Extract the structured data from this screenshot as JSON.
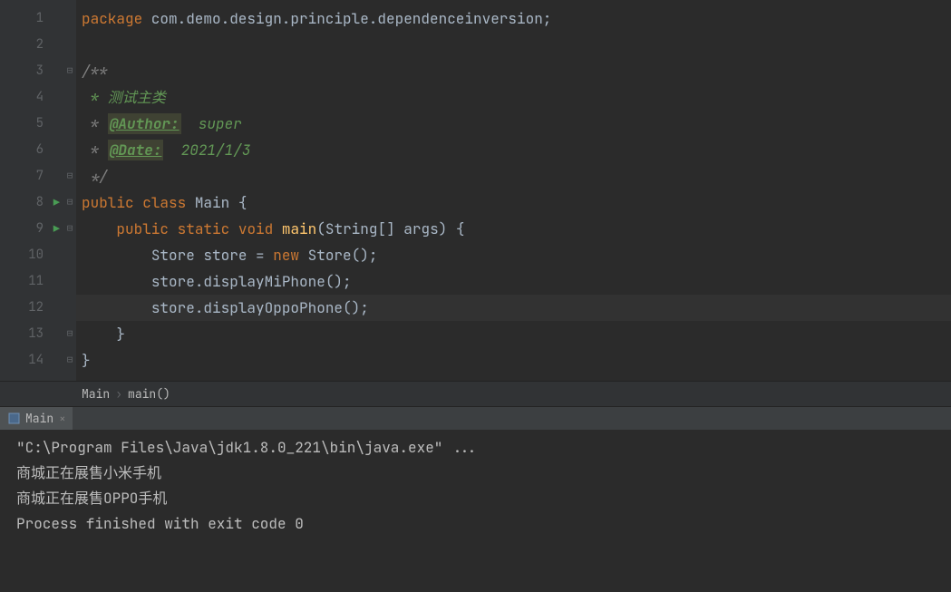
{
  "code": {
    "package_kw": "package",
    "package_name": " com.demo.design.principle.dependenceinversion;",
    "c_open": "/**",
    "c_l4": " * 测试主类",
    "c_star": " * ",
    "c_author_tag": "@Author:",
    "c_author_val": "  super",
    "c_date_tag": "@Date:",
    "c_date_val": "  2021/1/3",
    "c_close": " */",
    "public": "public",
    "class": "class",
    "main_cls": " Main {",
    "static": "static",
    "void": "void",
    "main_m": "main",
    "main_args": "(String[] args) {",
    "l10a": "Store store = ",
    "new": "new",
    "l10b": " Store();",
    "l11": "store.displayMiPhone();",
    "l12": "store.displayOppoPhone();",
    "l13": "}",
    "l14": "}"
  },
  "line_numbers": [
    "1",
    "2",
    "3",
    "4",
    "5",
    "6",
    "7",
    "8",
    "9",
    "10",
    "11",
    "12",
    "13",
    "14"
  ],
  "breadcrumb": {
    "a": "Main",
    "sep": "›",
    "b": "main()"
  },
  "run_tab": {
    "label": "Main",
    "close": "×"
  },
  "console": {
    "l1": "\"C:\\Program Files\\Java\\jdk1.8.0_221\\bin\\java.exe\" ...",
    "l2": "商城正在展售小米手机",
    "l3": "商城正在展售OPPO手机",
    "l4": "",
    "l5": "Process finished with exit code 0"
  }
}
